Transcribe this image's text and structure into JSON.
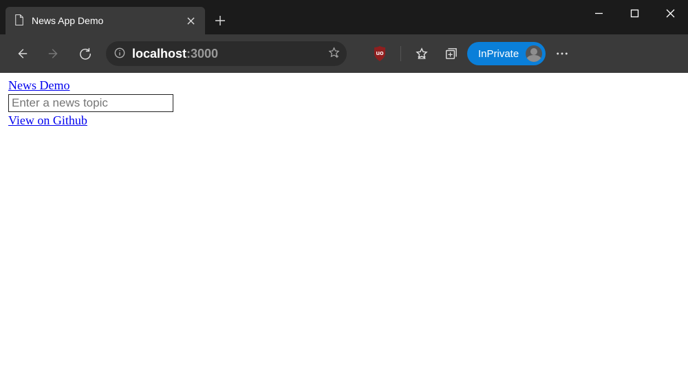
{
  "window": {
    "tab_title": "News App Demo",
    "inprivate_label": "InPrivate"
  },
  "address": {
    "host": "localhost",
    "port": ":3000"
  },
  "page": {
    "link_demo": "News Demo",
    "search_placeholder": "Enter a news topic",
    "link_github": "View on Github"
  },
  "icons": {
    "page": "page-icon",
    "close": "close-icon",
    "newtab": "plus-icon",
    "minimize": "minimize-icon",
    "maximize": "maximize-icon",
    "win_close": "close-icon",
    "back": "arrow-left-icon",
    "forward": "arrow-right-icon",
    "refresh": "refresh-icon",
    "site_info": "info-icon",
    "add_fav": "star-plus-icon",
    "ublock": "ublock-shield-icon",
    "favorites": "favorites-icon",
    "collections": "collections-icon",
    "avatar": "avatar-icon",
    "more": "more-icon"
  },
  "colors": {
    "titlebar": "#1b1b1b",
    "tab": "#3a3a3a",
    "toolbar": "#3a3a3a",
    "addressbar": "#2b2b2b",
    "accent": "#0a7fd9",
    "link": "#0000EE",
    "ublock_red": "#a52424"
  }
}
